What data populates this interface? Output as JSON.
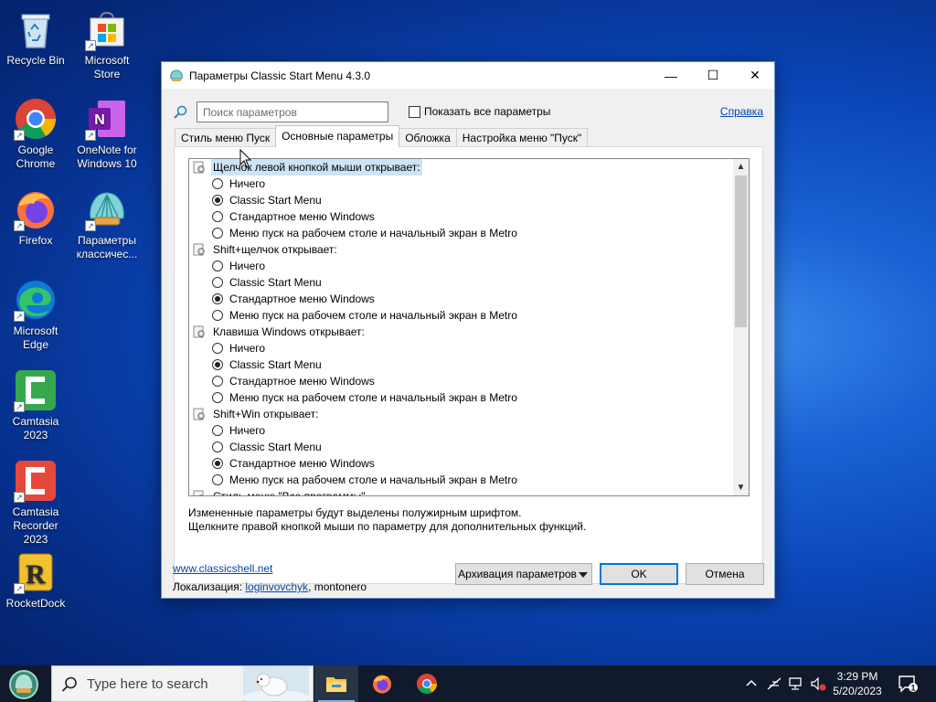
{
  "desktop": {
    "icons": [
      {
        "label": "Recycle Bin",
        "icon": "recycle-bin-icon"
      },
      {
        "label": "Microsoft Store",
        "icon": "store-icon"
      },
      {
        "label": "Google Chrome",
        "icon": "chrome-icon"
      },
      {
        "label": "OneNote for Windows 10",
        "icon": "onenote-icon"
      },
      {
        "label": "Firefox",
        "icon": "firefox-icon"
      },
      {
        "label": "Параметры классичес...",
        "icon": "shell-icon"
      },
      {
        "label": "Microsoft Edge",
        "icon": "edge-icon"
      },
      {
        "label": "Camtasia 2023",
        "icon": "camtasia-icon"
      },
      {
        "label": "Camtasia Recorder 2023",
        "icon": "camtasia-recorder-icon"
      },
      {
        "label": "RocketDock",
        "icon": "rocketdock-icon"
      }
    ]
  },
  "window": {
    "title": "Параметры Classic Start Menu 4.3.0",
    "controls": {
      "minimize": "—",
      "maximize": "☐",
      "close": "✕"
    },
    "search": {
      "placeholder": "Поиск параметров",
      "value": ""
    },
    "show_all": {
      "label": "Показать все параметры",
      "checked": false
    },
    "help_link": "Справка",
    "tabs": [
      {
        "label": "Стиль меню Пуск",
        "active": false
      },
      {
        "label": "Основные параметры",
        "active": true
      },
      {
        "label": "Обложка",
        "active": false
      },
      {
        "label": "Настройка меню \"Пуск\"",
        "active": false
      }
    ],
    "tree": [
      {
        "type": "group",
        "label": "Щелчок левой кнопкой мыши открывает:",
        "selected": true
      },
      {
        "type": "option",
        "label": "Ничего",
        "checked": false
      },
      {
        "type": "option",
        "label": "Classic Start Menu",
        "checked": true
      },
      {
        "type": "option",
        "label": "Стандартное меню Windows",
        "checked": false
      },
      {
        "type": "option",
        "label": "Меню пуск на рабочем столе и начальный экран в Metro",
        "checked": false
      },
      {
        "type": "group",
        "label": "Shift+щелчок открывает:",
        "selected": false
      },
      {
        "type": "option",
        "label": "Ничего",
        "checked": false
      },
      {
        "type": "option",
        "label": "Classic Start Menu",
        "checked": false
      },
      {
        "type": "option",
        "label": "Стандартное меню Windows",
        "checked": true
      },
      {
        "type": "option",
        "label": "Меню пуск на рабочем столе и начальный экран в Metro",
        "checked": false
      },
      {
        "type": "group",
        "label": "Клавиша Windows открывает:",
        "selected": false
      },
      {
        "type": "option",
        "label": "Ничего",
        "checked": false
      },
      {
        "type": "option",
        "label": "Classic Start Menu",
        "checked": true
      },
      {
        "type": "option",
        "label": "Стандартное меню Windows",
        "checked": false
      },
      {
        "type": "option",
        "label": "Меню пуск на рабочем столе и начальный экран в Metro",
        "checked": false
      },
      {
        "type": "group",
        "label": "Shift+Win открывает:",
        "selected": false
      },
      {
        "type": "option",
        "label": "Ничего",
        "checked": false
      },
      {
        "type": "option",
        "label": "Classic Start Menu",
        "checked": false
      },
      {
        "type": "option",
        "label": "Стандартное меню Windows",
        "checked": true
      },
      {
        "type": "option",
        "label": "Меню пуск на рабочем столе и начальный экран в Metro",
        "checked": false
      },
      {
        "type": "group",
        "label": "Стиль меню \"Все программы\"",
        "selected": false
      }
    ],
    "hint_line1": "Измененные параметры будут выделены полужирным шрифтом.",
    "hint_line2": "Щелкните правой кнопкой мыши по параметру для дополнительных функций.",
    "site_link": "www.classicshell.net",
    "locale_prefix": "Локализация: ",
    "locale_author1": "loginvovchyk",
    "locale_author2": ", montonero",
    "buttons": {
      "backup": "Архивация параметров",
      "ok": "OK",
      "cancel": "Отмена"
    }
  },
  "taskbar": {
    "search_placeholder": "Type here to search",
    "apps": [
      "file-explorer-icon",
      "firefox-icon",
      "chrome-icon"
    ],
    "time": "3:29 PM",
    "date": "5/20/2023",
    "notification_count": "1"
  }
}
